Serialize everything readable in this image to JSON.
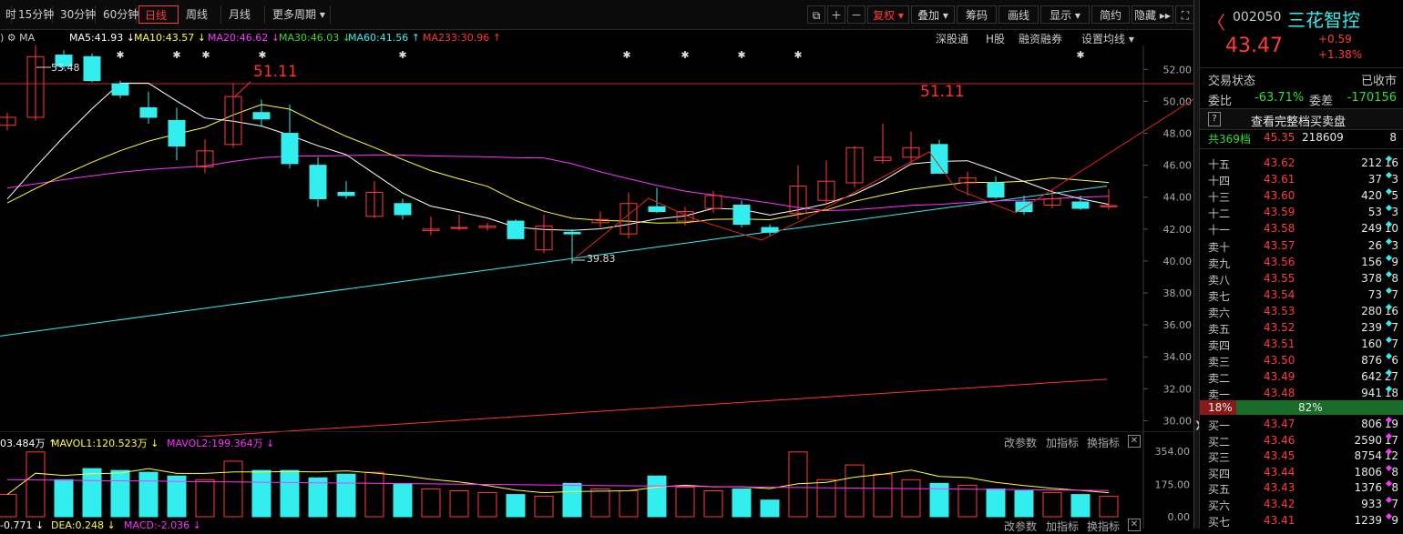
{
  "toolbar": {
    "tabs": [
      "时",
      "15分钟",
      "30分钟",
      "60分钟",
      "日线",
      "周线",
      "月线",
      "更多周期"
    ],
    "active_tab": "日线",
    "right_buttons": [
      "复权",
      "叠加",
      "筹码",
      "画线",
      "显示",
      "简约",
      "隐藏"
    ],
    "icon_buttons": [
      "copy-icon",
      "plus-icon",
      "minus-icon"
    ]
  },
  "ma_bar": {
    "items": [
      {
        "text": "MA5:41.93",
        "color": "#ffffff",
        "arrow": "↓"
      },
      {
        "text": "MA10:43.57",
        "color": "#ffff33",
        "arrow": "↓"
      },
      {
        "text": "MA20:46.62",
        "color": "#ff33ff",
        "arrow": "↓"
      },
      {
        "text": "MA30:46.03",
        "color": "#33dd33",
        "arrow": "↓"
      },
      {
        "text": "MA60:41.56",
        "color": "#33eeee",
        "arrow": "↑"
      },
      {
        "text": "MA233:30.96",
        "color": "#ff3333",
        "arrow": "↑"
      }
    ],
    "prefix": "MA",
    "links": [
      "深股通",
      "H股",
      "融资融券",
      "设置均线"
    ]
  },
  "chart_data": {
    "type": "candlestick",
    "y_ticks": [
      "52.00",
      "50.00",
      "48.00",
      "46.00",
      "44.00",
      "42.00",
      "40.00",
      "38.00",
      "36.00",
      "34.00",
      "32.00",
      "30.00"
    ],
    "ylim": [
      29.0,
      53.5
    ],
    "annotations": {
      "high": "51.11",
      "low": "39.83",
      "left_high": "53.48",
      "right_label": "51.11"
    },
    "candles": [
      [
        48.5,
        49.3,
        48.2,
        49.0
      ],
      [
        49.0,
        53.5,
        48.8,
        52.8
      ],
      [
        52.9,
        53.2,
        52.0,
        52.2
      ],
      [
        52.8,
        53.0,
        51.2,
        51.3
      ],
      [
        51.1,
        51.3,
        50.2,
        50.4
      ],
      [
        49.6,
        50.6,
        48.6,
        49.0
      ],
      [
        48.8,
        49.6,
        46.3,
        47.2
      ],
      [
        45.9,
        47.6,
        45.5,
        46.9
      ],
      [
        47.3,
        51.11,
        47.1,
        50.3
      ],
      [
        49.3,
        50.1,
        48.4,
        48.9
      ],
      [
        48.0,
        49.8,
        45.8,
        46.1
      ],
      [
        46.0,
        46.5,
        43.4,
        43.9
      ],
      [
        44.3,
        45.0,
        43.9,
        44.1
      ],
      [
        42.8,
        45.0,
        42.7,
        44.3
      ],
      [
        43.6,
        43.9,
        42.6,
        42.9
      ],
      [
        41.9,
        42.8,
        41.6,
        42.0
      ],
      [
        42.1,
        42.9,
        41.9,
        42.1
      ],
      [
        42.1,
        42.4,
        41.9,
        42.2
      ],
      [
        42.5,
        42.6,
        41.4,
        41.4
      ],
      [
        40.7,
        42.9,
        40.5,
        42.2
      ],
      [
        41.8,
        42.0,
        39.83,
        41.7
      ],
      [
        42.4,
        43.1,
        42.1,
        42.6
      ],
      [
        41.7,
        44.3,
        41.4,
        43.6
      ],
      [
        43.4,
        44.6,
        43.0,
        43.1
      ],
      [
        42.5,
        43.4,
        42.2,
        43.1
      ],
      [
        43.3,
        44.4,
        43.0,
        44.1
      ],
      [
        43.5,
        43.8,
        42.1,
        42.3
      ],
      [
        42.1,
        42.3,
        41.6,
        41.8
      ],
      [
        43.0,
        46.0,
        42.6,
        44.7
      ],
      [
        43.8,
        46.3,
        43.5,
        45.0
      ],
      [
        44.9,
        47.2,
        44.6,
        47.1
      ],
      [
        46.3,
        48.6,
        46.1,
        46.5
      ],
      [
        46.5,
        48.1,
        46.0,
        47.1
      ],
      [
        47.3,
        47.6,
        45.6,
        45.5
      ],
      [
        44.9,
        45.6,
        44.1,
        45.2
      ],
      [
        44.9,
        45.3,
        43.9,
        44.0
      ],
      [
        43.7,
        44.1,
        42.9,
        43.1
      ],
      [
        43.5,
        44.5,
        43.3,
        43.9
      ],
      [
        43.7,
        44.1,
        43.2,
        43.3
      ],
      [
        43.4,
        44.5,
        43.2,
        43.47
      ]
    ],
    "ma5_color": "#ffffff",
    "ma10_color": "#ffff33",
    "ma20_color": "#ff33ff",
    "ma30_color": "#33dd33",
    "ma60": {
      "from": 35.3,
      "to": 44.7,
      "color": "#33eeee"
    },
    "ma233": {
      "from": 28.2,
      "to": 32.6,
      "color": "#ff3333"
    },
    "volume": {
      "values": [
        120,
        350,
        200,
        260,
        250,
        240,
        220,
        200,
        300,
        250,
        250,
        210,
        230,
        240,
        180,
        150,
        140,
        130,
        120,
        110,
        180,
        150,
        140,
        220,
        160,
        140,
        150,
        90,
        350,
        200,
        280,
        230,
        200,
        180,
        170,
        150,
        140,
        130,
        120,
        110
      ],
      "ylim": [
        0,
        354
      ],
      "y_ticks": [
        "354.00",
        "175.00",
        "0.00"
      ],
      "mavol_color": "#ffff33",
      "mavol2_color": "#ff33ff"
    }
  },
  "vol_bar": {
    "items": [
      {
        "text": "03.484万",
        "color": "#ffffff",
        "arrow": "↑"
      },
      {
        "text": "MAVOL1:120.523万",
        "color": "#ffff33",
        "arrow": "↓"
      },
      {
        "text": "MAVOL2:199.364万",
        "color": "#ff33ff",
        "arrow": "↓"
      }
    ],
    "links": [
      "改参数",
      "加指标",
      "换指标"
    ]
  },
  "macd_bar": {
    "items": [
      {
        "text": "-0.771",
        "color": "#ffffff",
        "arrow": "↓"
      },
      {
        "text": "DEA:0.248",
        "color": "#ffff33",
        "arrow": "↓"
      },
      {
        "text": "MACD:-2.036",
        "color": "#ff33ff",
        "arrow": "↓"
      }
    ],
    "links": [
      "改参数",
      "加指标",
      "换指标"
    ]
  },
  "quote": {
    "code": "002050",
    "name": "三花智控",
    "price": "43.47",
    "change": "+0.59",
    "change_pct": "+1.38%",
    "status_label": "交易状态",
    "status_value": "已收市",
    "wb_label": "委比",
    "wb_value": "-63.71%",
    "wc_label": "委差",
    "wc_value": "-170156",
    "help_icon": "?",
    "full_book_label": "查看完整档买卖盘",
    "total": {
      "label": "共369档",
      "price": "45.35",
      "vol": "218609",
      "cnt": "8"
    }
  },
  "asks": [
    {
      "label": "十五",
      "price": "43.62",
      "vol": "212",
      "cnt": "16"
    },
    {
      "label": "十四",
      "price": "43.61",
      "vol": "37",
      "cnt": "3"
    },
    {
      "label": "十三",
      "price": "43.60",
      "vol": "420",
      "cnt": "5"
    },
    {
      "label": "十二",
      "price": "43.59",
      "vol": "53",
      "cnt": "3"
    },
    {
      "label": "十一",
      "price": "43.58",
      "vol": "249",
      "cnt": "10"
    },
    {
      "label": "卖十",
      "price": "43.57",
      "vol": "26",
      "cnt": "3"
    },
    {
      "label": "卖九",
      "price": "43.56",
      "vol": "156",
      "cnt": "9"
    },
    {
      "label": "卖八",
      "price": "43.55",
      "vol": "378",
      "cnt": "8"
    },
    {
      "label": "卖七",
      "price": "43.54",
      "vol": "73",
      "cnt": "7"
    },
    {
      "label": "卖六",
      "price": "43.53",
      "vol": "280",
      "cnt": "16"
    },
    {
      "label": "卖五",
      "price": "43.52",
      "vol": "239",
      "cnt": "7"
    },
    {
      "label": "卖四",
      "price": "43.51",
      "vol": "160",
      "cnt": "7"
    },
    {
      "label": "卖三",
      "price": "43.50",
      "vol": "876",
      "cnt": "6"
    },
    {
      "label": "卖二",
      "price": "43.49",
      "vol": "642",
      "cnt": "27"
    },
    {
      "label": "卖一",
      "price": "43.48",
      "vol": "941",
      "cnt": "18"
    }
  ],
  "ratio": {
    "sell": "18%",
    "buy": "82%",
    "sell_frac": 0.18
  },
  "bids": [
    {
      "label": "买一",
      "price": "43.47",
      "vol": "806",
      "cnt": "19"
    },
    {
      "label": "买二",
      "price": "43.46",
      "vol": "2590",
      "cnt": "17"
    },
    {
      "label": "买三",
      "price": "43.45",
      "vol": "8754",
      "cnt": "12"
    },
    {
      "label": "买四",
      "price": "43.44",
      "vol": "1806",
      "cnt": "8"
    },
    {
      "label": "买五",
      "price": "43.43",
      "vol": "1376",
      "cnt": "8"
    },
    {
      "label": "买六",
      "price": "43.42",
      "vol": "933",
      "cnt": "7"
    },
    {
      "label": "买七",
      "price": "43.41",
      "vol": "1239",
      "cnt": "9"
    }
  ]
}
